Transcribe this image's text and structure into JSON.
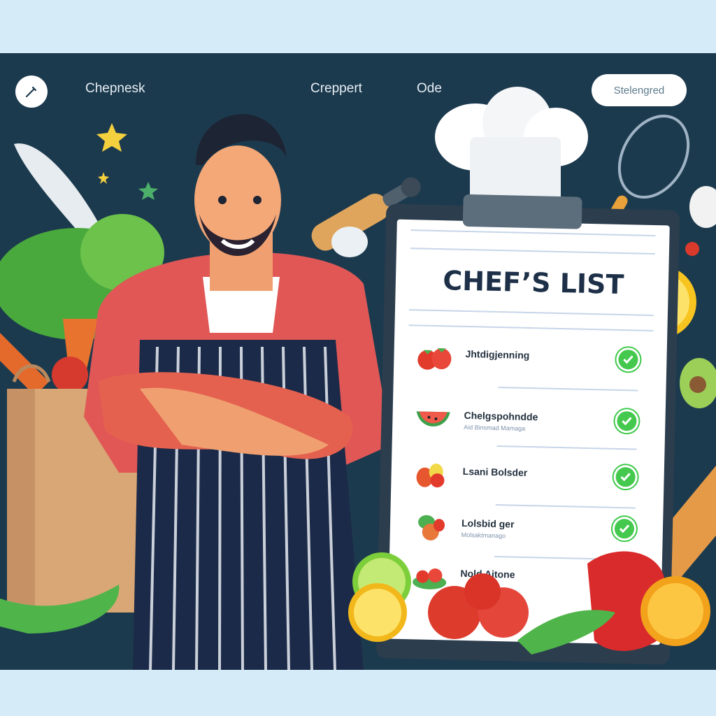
{
  "nav": {
    "items": [
      {
        "label": "Chepnesk"
      },
      {
        "label": "Creppert"
      },
      {
        "label": "Ode"
      }
    ],
    "action_button_label": "Stelengred",
    "edit_icon": "pencil-icon"
  },
  "list": {
    "title": "CHEF’S LIST",
    "items": [
      {
        "label": "Jhtdigjenning",
        "sub": "",
        "checked": true,
        "thumb": "strawberries"
      },
      {
        "label": "Chelgspohndde",
        "sub": "Aid Binsmad Mamaga",
        "checked": true,
        "thumb": "watermelon"
      },
      {
        "label": "Lsani Bolsder",
        "sub": "",
        "checked": true,
        "thumb": "berries"
      },
      {
        "label": "Lolsbid ger",
        "sub": "Molsaktmanago",
        "checked": true,
        "thumb": "berries"
      },
      {
        "label": "Nold Aitone",
        "sub": "",
        "checked": true,
        "thumb": "salad"
      }
    ],
    "check_icon": "checkmark-icon"
  },
  "colors": {
    "page_background": "#d6ebf8",
    "frame_background": "#1c3a4e",
    "check_green": "#3fc94a",
    "title_navy": "#1d3048",
    "apron_navy": "#1b2a48",
    "shirt_red": "#e05756"
  }
}
